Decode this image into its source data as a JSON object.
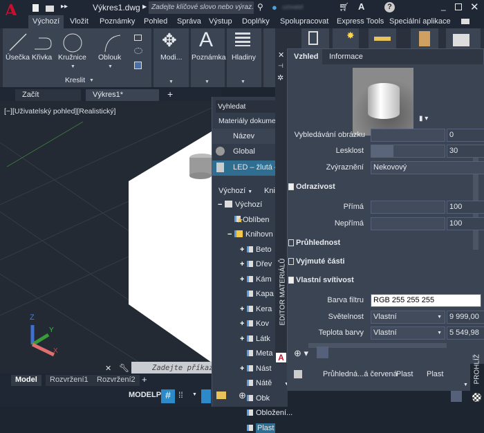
{
  "titlebar": {
    "filename": "Výkres1.dwg",
    "search_placeholder": "Zadejte klíčové slovo nebo výraz.",
    "user": "uzivatel"
  },
  "ribbon_tabs": [
    "Výchozí",
    "Vložit",
    "Poznámky",
    "Pohled",
    "Správa",
    "Výstup",
    "Doplňky",
    "Spolupracovat",
    "Express Tools",
    "Speciální aplikace"
  ],
  "ribbon": {
    "draw": {
      "line": "Úsečka",
      "polyline": "Křivka",
      "circle": "Kružnice",
      "arc": "Oblouk",
      "panel": "Kreslit"
    },
    "modify": "Modi...",
    "annotation": "Poznámka",
    "layers": "Hladiny"
  },
  "file_tabs": [
    "Začít",
    "Výkres1*"
  ],
  "viewport": {
    "label": "[−][Uživatelský pohled][Realistický]",
    "axes": {
      "x": "X",
      "y": "Y",
      "z": "Z"
    }
  },
  "command": {
    "placeholder": "Zadejte příkaz"
  },
  "layout_tabs": [
    "Model",
    "Rozvržení1",
    "Rozvržení2"
  ],
  "status": {
    "model": "MODELP"
  },
  "browser": {
    "search": "Vyhledat",
    "doc_materials": "Materiály dokume",
    "col_name": "Název",
    "materials": [
      "Global",
      "LED – žlutá – z"
    ],
    "library_dropdown": "Výchozí",
    "library_col": "Knih",
    "tree": [
      {
        "label": "Výchozí",
        "expand": "−"
      },
      {
        "label": "Oblíben",
        "expand": ""
      },
      {
        "label": "Knihovn",
        "expand": "−"
      },
      {
        "label": "Beto",
        "expand": "+"
      },
      {
        "label": "Dřev",
        "expand": "+"
      },
      {
        "label": "Kám",
        "expand": "+"
      },
      {
        "label": "Kapa",
        "expand": ""
      },
      {
        "label": "Kera",
        "expand": "+"
      },
      {
        "label": "Kov",
        "expand": "+"
      },
      {
        "label": "Látk",
        "expand": "+"
      },
      {
        "label": "Meta",
        "expand": ""
      },
      {
        "label": "Nást",
        "expand": "+"
      },
      {
        "label": "Nátě",
        "expand": ""
      },
      {
        "label": "Obk",
        "expand": ""
      },
      {
        "label": "Obložení...",
        "expand": ""
      },
      {
        "label": "Plast",
        "expand": ""
      }
    ],
    "list_row": {
      "name": "Průhledná...á červená",
      "type": "Plast",
      "category": "Plast"
    },
    "side_label": "PROHLÍŽ"
  },
  "editor": {
    "tabs": [
      "Vzhled",
      "Informace"
    ],
    "side_label": "EDITOR MATERIÁLŮ",
    "image_fade": {
      "label": "Vybledávání obrázku",
      "value": "0"
    },
    "glossiness": {
      "label": "Lesklost",
      "value": "30",
      "percent": 30
    },
    "highlights": {
      "label": "Zvýraznění",
      "value": "Nekovový"
    },
    "reflectivity": {
      "title": "Odrazivost",
      "checked": true,
      "direct": {
        "label": "Přímá",
        "value": "100"
      },
      "oblique": {
        "label": "Nepřímá",
        "value": "100"
      }
    },
    "transparency": {
      "title": "Průhlednost",
      "checked": false
    },
    "cutouts": {
      "title": "Vyjmuté části",
      "checked": false
    },
    "self_illum": {
      "title": "Vlastní svítivost",
      "checked": true,
      "filter_color": {
        "label": "Barva filtru",
        "value": "RGB 255 255 255"
      },
      "luminance": {
        "label": "Světelnost",
        "mode": "Vlastní",
        "value": "9 999,00"
      },
      "color_temp": {
        "label": "Teplota barvy",
        "mode": "Vlastní",
        "value": "5 549,98"
      }
    }
  },
  "colors": {
    "accent": "#2d8ac9",
    "selected": "#2f6d91",
    "autocad_red": "#c8102e"
  }
}
